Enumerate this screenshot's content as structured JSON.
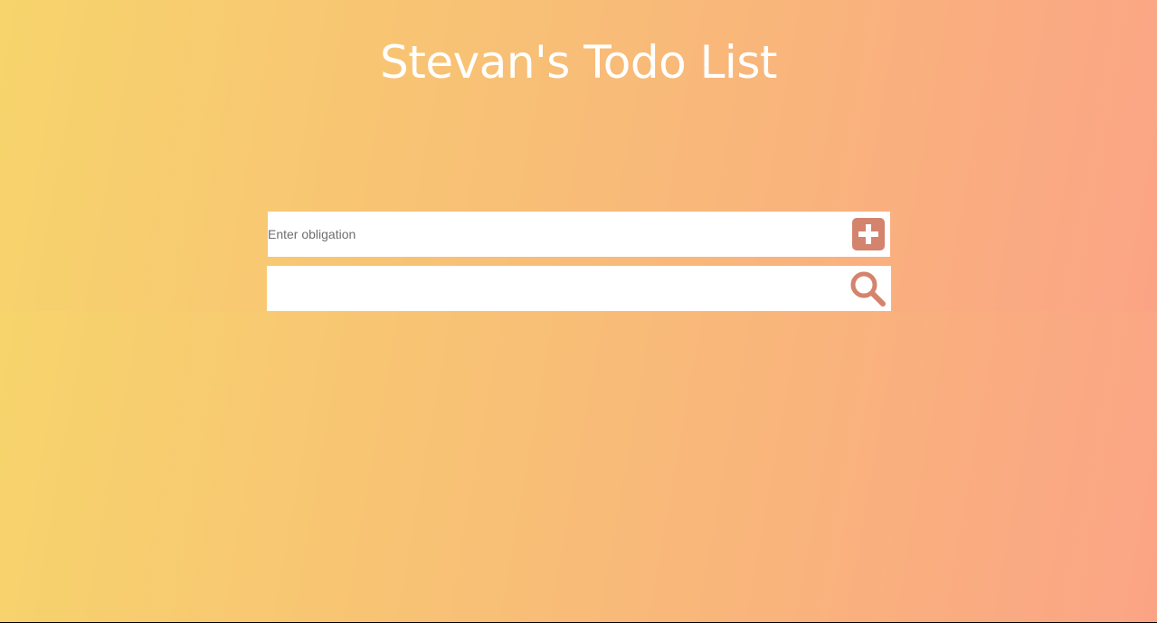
{
  "header": {
    "title": "Stevan's Todo List"
  },
  "add_form": {
    "placeholder": "Enter obligation",
    "value": "",
    "button_icon": "plus-square-icon"
  },
  "search_form": {
    "placeholder": "",
    "value": "",
    "button_icon": "search-icon"
  },
  "colors": {
    "gradient_start": "#f7d46c",
    "gradient_end": "#fba485",
    "accent": "#d4836d",
    "title": "#ffffff"
  }
}
